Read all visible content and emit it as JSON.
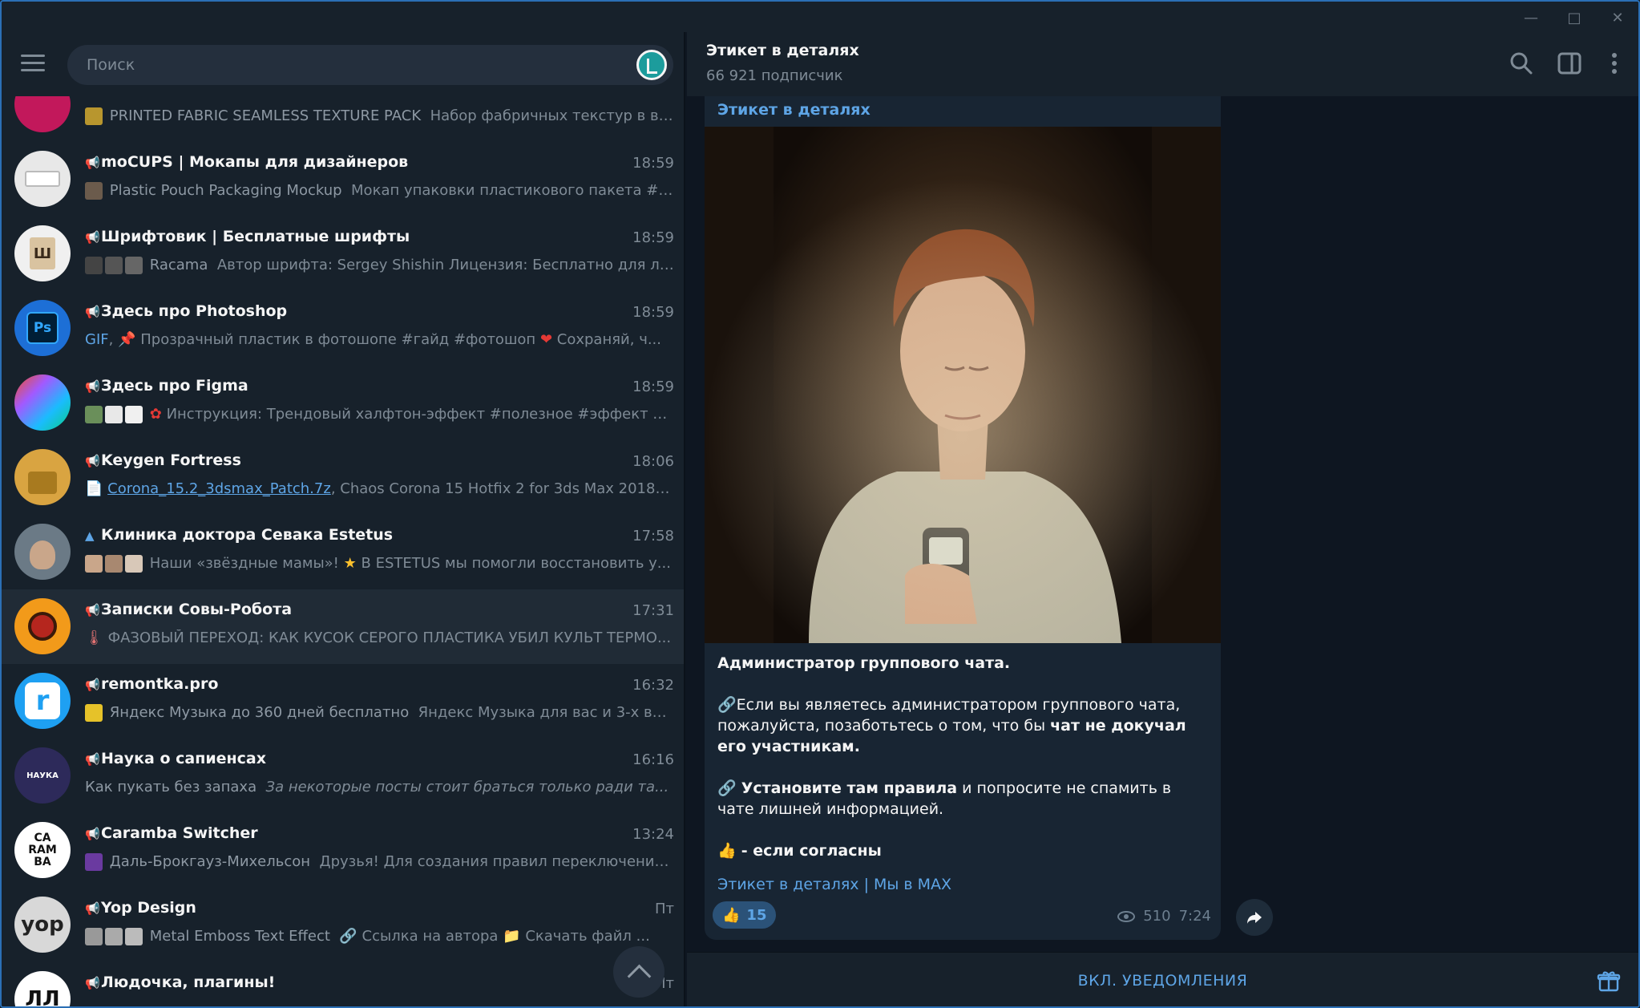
{
  "search": {
    "placeholder": "Поиск"
  },
  "chats": [
    {
      "name": "",
      "time": "",
      "preview_title": "PRINTED FABRIC SEAMLESS TEXTURE PACK",
      "preview_text": "Набор фабричных текстур в вы...",
      "avatar_color": "#c2185b"
    },
    {
      "name": "moCUPS | Мокапы для дизайнеров",
      "time": "18:59",
      "preview_title": "Plastic Pouch Packaging Mockup",
      "preview_text": "Мокап упаковки пластикового пакета #а...",
      "avatar_color": "#e8e8e8"
    },
    {
      "name": "Шрифтовик | Бесплатные шрифты",
      "time": "18:59",
      "preview_title": "Racama",
      "preview_text": "Автор шрифта: Sergey Shishin Лицензия: Бесплатно для ли...",
      "avatar_color": "#f0f0f0"
    },
    {
      "name": "Здесь про Photoshop",
      "time": "18:59",
      "preview_gif": "GIF",
      "preview_text": "Прозрачный пластик в фотошопе #гайд #фотошоп",
      "preview_tail": "Сохраняй, ч...",
      "avatar_color": "#1d6fd6",
      "avatar_text": "Ps"
    },
    {
      "name": "Здесь про Figma",
      "time": "18:59",
      "preview_text": "Инструкция: Трендовый халфтон-эффект #полезное #эффект #...",
      "avatar_color": "#c84fd8"
    },
    {
      "name": "Keygen Fortress",
      "time": "18:06",
      "preview_link": "Corona_15.2_3dsmax_Patch.7z",
      "preview_text": "Chaos Corona 15 Hotfix 2 for 3ds Max 2018 - ...",
      "avatar_color": "#d9a441"
    },
    {
      "name": "Клиника доктора Севака Estetus",
      "time": "17:58",
      "preview_text": "Наши «звёздные мамы»!",
      "preview_tail": "В ESTETUS мы помогли восстановить у...",
      "avatar_color": "#6b7a86"
    },
    {
      "name": "Записки Совы-Робота",
      "time": "17:31",
      "preview_text": "ФАЗОВЫЙ ПЕРЕХОД: КАК КУСОК СЕРОГО ПЛАСТИКА УБИЛ КУЛЬТ ТЕРМО...",
      "avatar_color": "#f29a1a"
    },
    {
      "name": "remontka.pro",
      "time": "16:32",
      "preview_title": "Яндекс Музыка до 360 дней бесплатно",
      "preview_text": "Яндекс Музыка для вас и 3-х ваш...",
      "avatar_color": "#1ea0f2",
      "avatar_text": "r"
    },
    {
      "name": "Наука о сапиенсах",
      "time": "16:16",
      "preview_title": "Как пукать без запаха",
      "preview_italic": "За некоторые посты стоит браться только ради та...",
      "avatar_color": "#2d2a5a",
      "avatar_text": "НАУКА"
    },
    {
      "name": "Caramba Switcher",
      "time": "13:24",
      "preview_title": "Даль-Брокгауз-Михельсон",
      "preview_text": "Друзья! Для создания правил переключения ...",
      "avatar_color": "#ffffff",
      "avatar_text": "CA RAM BA"
    },
    {
      "name": "Yop Design",
      "time": "Пт",
      "preview_title": "Metal Emboss Text Effect",
      "preview_text": "Ссылка на автора",
      "preview_tail": "Скачать файл ...",
      "avatar_color": "#d8d8d8",
      "avatar_text": "yop"
    },
    {
      "name": "Людочка, плагины!",
      "time": "Пт",
      "preview_text": "",
      "avatar_color": "#ffffff",
      "avatar_text": "ЛЛ"
    }
  ],
  "channel": {
    "title": "Этикет в деталях",
    "subscribers": "66 921 подписчик"
  },
  "message": {
    "author": "Этикет в деталях",
    "heading": "Администратор группового чата.",
    "p1_a": "Если вы являетесь администратором группового чата, пожалуйста, позаботьтесь о том, что бы ",
    "p1_b": "чат не докучал его участникам.",
    "p2_a": "Установите там правила",
    "p2_b": " и попросите не спамить в чате лишней информацией.",
    "p3": "- если согласны",
    "link1": "Этикет в деталях",
    "separator": "|",
    "link2": "Мы в MAX",
    "reaction_count": "15",
    "views": "510",
    "time": "7:24"
  },
  "bottom": {
    "notify_label": "ВКЛ. УВЕДОМЛЕНИЯ"
  },
  "colors": {
    "accent": "#5ea5e6",
    "bg": "#0e1621",
    "panel": "#17212b",
    "bubble": "#182533"
  }
}
